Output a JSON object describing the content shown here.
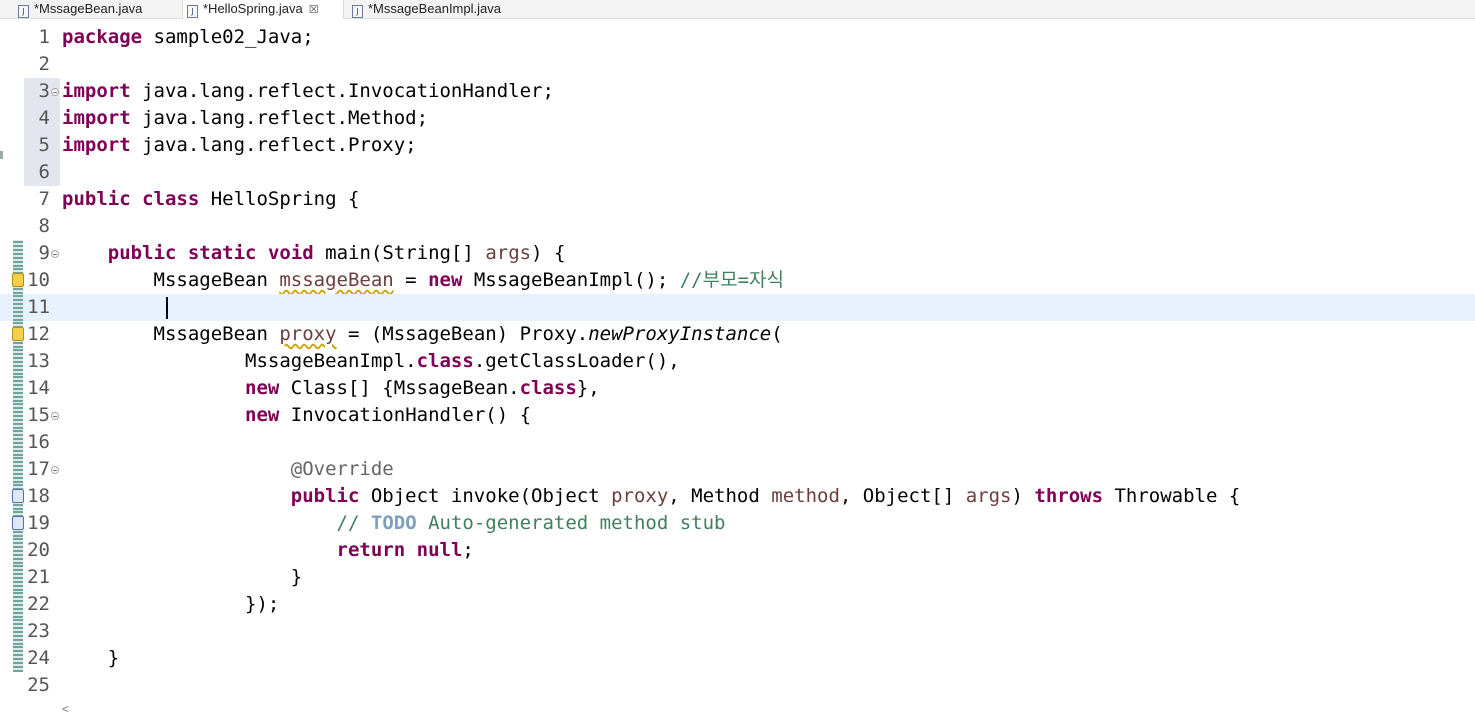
{
  "tabs": [
    {
      "label": "*MssageBean.java",
      "active": false,
      "icon": "java-file-icon"
    },
    {
      "label": "*HelloSpring.java",
      "active": true,
      "icon": "java-file-icon",
      "close_glyph": "☒"
    },
    {
      "label": "*MssageBeanImpl.java",
      "active": false,
      "icon": "java-file-icon"
    }
  ],
  "icon_glyph": "J",
  "editor": {
    "current_line": 11,
    "lines": [
      {
        "n": "1",
        "text": "package sample02_Java;"
      },
      {
        "n": "2",
        "text": ""
      },
      {
        "n": "3",
        "text": "import java.lang.reflect.InvocationHandler;",
        "fold": true
      },
      {
        "n": "4",
        "text": "import java.lang.reflect.Method;"
      },
      {
        "n": "5",
        "text": "import java.lang.reflect.Proxy;"
      },
      {
        "n": "6",
        "text": ""
      },
      {
        "n": "7",
        "text": "public class HelloSpring {"
      },
      {
        "n": "8",
        "text": ""
      },
      {
        "n": "9",
        "text": "    public static void main(String[] args) {",
        "fold": true
      },
      {
        "n": "10",
        "text": "        MssageBean mssageBean = new MssageBeanImpl(); //부모=자식",
        "marker": "warning"
      },
      {
        "n": "11",
        "text": "        "
      },
      {
        "n": "12",
        "text": "        MssageBean proxy = (MssageBean) Proxy.newProxyInstance(",
        "marker": "warning"
      },
      {
        "n": "13",
        "text": "                MssageBeanImpl.class.getClassLoader(),"
      },
      {
        "n": "14",
        "text": "                new Class[] {MssageBean.class},"
      },
      {
        "n": "15",
        "text": "                new InvocationHandler() {",
        "fold": true
      },
      {
        "n": "16",
        "text": ""
      },
      {
        "n": "17",
        "text": "                    @Override",
        "fold": true
      },
      {
        "n": "18",
        "text": "                    public Object invoke(Object proxy, Method method, Object[] args) throws Throwable {",
        "marker": "override"
      },
      {
        "n": "19",
        "text": "                        // TODO Auto-generated method stub",
        "marker": "override"
      },
      {
        "n": "20",
        "text": "                        return null;"
      },
      {
        "n": "21",
        "text": "                    }"
      },
      {
        "n": "22",
        "text": "                });"
      },
      {
        "n": "23",
        "text": ""
      },
      {
        "n": "24",
        "text": "    }"
      },
      {
        "n": "25",
        "text": ""
      }
    ]
  },
  "scroll_hint": "<",
  "colors": {
    "keyword": "#7f0055",
    "comment": "#3f7f5f",
    "variable": "#6a3e3e",
    "annotation": "#646464",
    "current_line": "#e8f2fe"
  }
}
